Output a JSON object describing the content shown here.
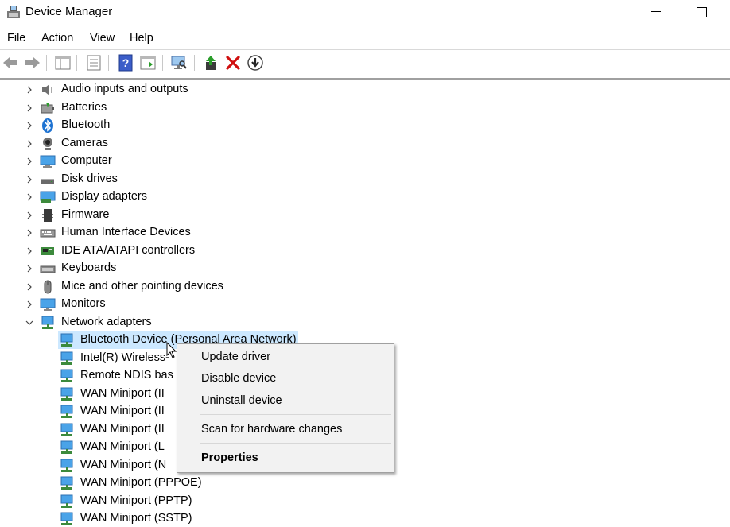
{
  "window": {
    "title": "Device Manager"
  },
  "menu": {
    "file": "File",
    "action": "Action",
    "view": "View",
    "help": "Help"
  },
  "toolbar": {
    "buttons": [
      "back-arrow-icon",
      "forward-arrow-icon",
      "show-hide-tree-icon",
      "properties-icon",
      "help-icon",
      "run-icon",
      "scan-hardware-icon",
      "update-driver-icon",
      "uninstall-icon",
      "disable-device-icon"
    ]
  },
  "tree": {
    "categories": [
      {
        "label": "Audio inputs and outputs",
        "icon": "speaker-icon"
      },
      {
        "label": "Batteries",
        "icon": "battery-icon"
      },
      {
        "label": "Bluetooth",
        "icon": "bluetooth-icon"
      },
      {
        "label": "Cameras",
        "icon": "camera-icon"
      },
      {
        "label": "Computer",
        "icon": "computer-icon"
      },
      {
        "label": "Disk drives",
        "icon": "disk-drive-icon"
      },
      {
        "label": "Display adapters",
        "icon": "display-adapter-icon"
      },
      {
        "label": "Firmware",
        "icon": "firmware-icon"
      },
      {
        "label": "Human Interface Devices",
        "icon": "hid-icon"
      },
      {
        "label": "IDE ATA/ATAPI controllers",
        "icon": "ide-controller-icon"
      },
      {
        "label": "Keyboards",
        "icon": "keyboard-icon"
      },
      {
        "label": "Mice and other pointing devices",
        "icon": "mouse-icon"
      },
      {
        "label": "Monitors",
        "icon": "monitor-icon"
      },
      {
        "label": "Network adapters",
        "icon": "network-adapter-icon"
      }
    ],
    "network_children": [
      "Bluetooth Device (Personal Area Network)",
      "Intel(R) Wireless-",
      "Remote NDIS bas",
      "WAN Miniport (II",
      "WAN Miniport (II",
      "WAN Miniport (II",
      "WAN Miniport (L",
      "WAN Miniport (N",
      "WAN Miniport (PPPOE)",
      "WAN Miniport (PPTP)",
      "WAN Miniport (SSTP)"
    ]
  },
  "context_menu": {
    "update_driver": "Update driver",
    "disable_device": "Disable device",
    "uninstall_device": "Uninstall device",
    "scan": "Scan for hardware changes",
    "properties": "Properties"
  },
  "colors": {
    "selection": "#cce8ff",
    "menu_bg": "#f2f2f2",
    "uninstall_red": "#d01010",
    "update_green": "#2a9d2a"
  }
}
